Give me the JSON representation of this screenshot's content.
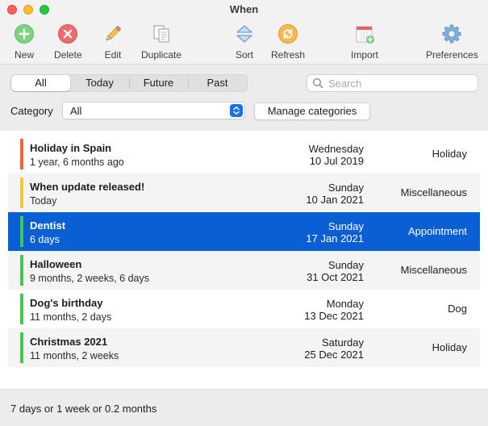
{
  "window": {
    "title": "When"
  },
  "toolbar": {
    "new_label": "New",
    "delete_label": "Delete",
    "edit_label": "Edit",
    "duplicate_label": "Duplicate",
    "sort_label": "Sort",
    "refresh_label": "Refresh",
    "import_label": "Import",
    "preferences_label": "Preferences"
  },
  "filter": {
    "segments": [
      "All",
      "Today",
      "Future",
      "Past"
    ],
    "active_segment": "All",
    "search_placeholder": "Search",
    "search_value": "",
    "category_label": "Category",
    "category_value": "All",
    "manage_label": "Manage categories"
  },
  "events": [
    {
      "name": "Holiday in Spain",
      "since": "1 year, 6 months ago",
      "weekday": "Wednesday",
      "date": "10 Jul 2019",
      "category": "Holiday",
      "color": "#f0643b",
      "selected": false
    },
    {
      "name": "When update released!",
      "since": "Today",
      "weekday": "Sunday",
      "date": "10 Jan 2021",
      "category": "Miscellaneous",
      "color": "#f8c630",
      "selected": false
    },
    {
      "name": "Dentist",
      "since": "6 days",
      "weekday": "Sunday",
      "date": "17 Jan 2021",
      "category": "Appointment",
      "color": "#3fca4a",
      "selected": true
    },
    {
      "name": "Halloween",
      "since": "9 months, 2 weeks, 6 days",
      "weekday": "Sunday",
      "date": "31 Oct 2021",
      "category": "Miscellaneous",
      "color": "#3fca4a",
      "selected": false
    },
    {
      "name": "Dog's birthday",
      "since": "11 months, 2 days",
      "weekday": "Monday",
      "date": "13 Dec 2021",
      "category": "Dog",
      "color": "#3fca4a",
      "selected": false
    },
    {
      "name": "Christmas 2021",
      "since": "11 months, 2 weeks",
      "weekday": "Saturday",
      "date": "25 Dec 2021",
      "category": "Holiday",
      "color": "#3fca4a",
      "selected": false
    }
  ],
  "status": {
    "text": "7 days or 1 week or 0.2 months"
  },
  "colors": {
    "accent": "#0a5fd4",
    "select_stepper": "#1a6ef6"
  },
  "icons": {
    "new": "plus-circle-icon",
    "delete": "x-circle-icon",
    "edit": "pencil-icon",
    "duplicate": "duplicate-pages-icon",
    "sort": "up-down-chevrons-icon",
    "refresh": "refresh-icon",
    "import": "calendar-import-icon",
    "preferences": "gear-icon",
    "search": "magnifier-icon"
  }
}
